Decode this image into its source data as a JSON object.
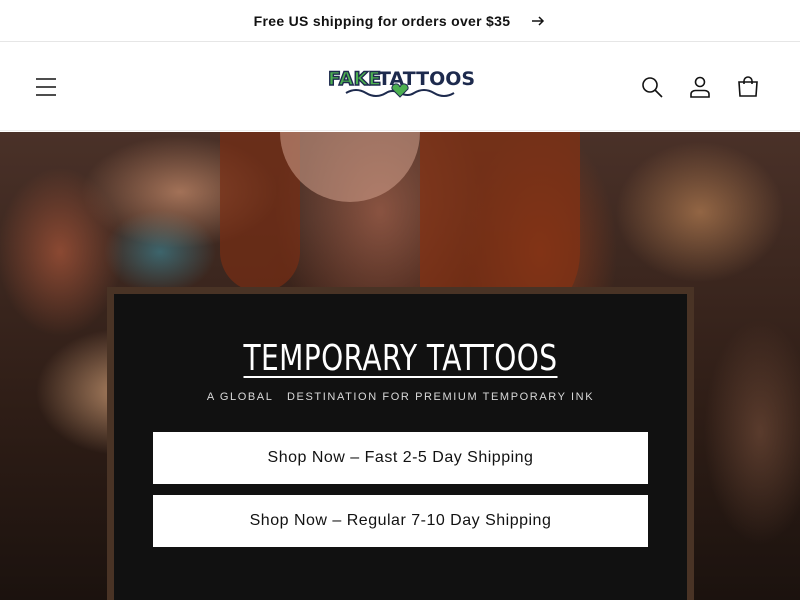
{
  "announcement": {
    "text": "Free US shipping for orders over $35",
    "arrow_icon": "arrow-right-icon"
  },
  "header": {
    "logo_text": "FAKETATTOOS",
    "icons": {
      "menu": "hamburger-menu-icon",
      "search": "search-icon",
      "account": "user-icon",
      "cart": "cart-icon"
    },
    "colors": {
      "logo_green": "#4caf50",
      "logo_navy": "#1d2a4d"
    }
  },
  "hero": {
    "title": "TEMPORARY TATTOOS",
    "subtitle": "A GLOBAL   DESTINATION FOR PREMIUM TEMPORARY INK",
    "buttons": [
      {
        "label": "Shop Now – Fast 2-5 Day Shipping"
      },
      {
        "label": "Shop Now – Regular 7-10 Day Shipping"
      }
    ],
    "box_color": "#111111"
  }
}
